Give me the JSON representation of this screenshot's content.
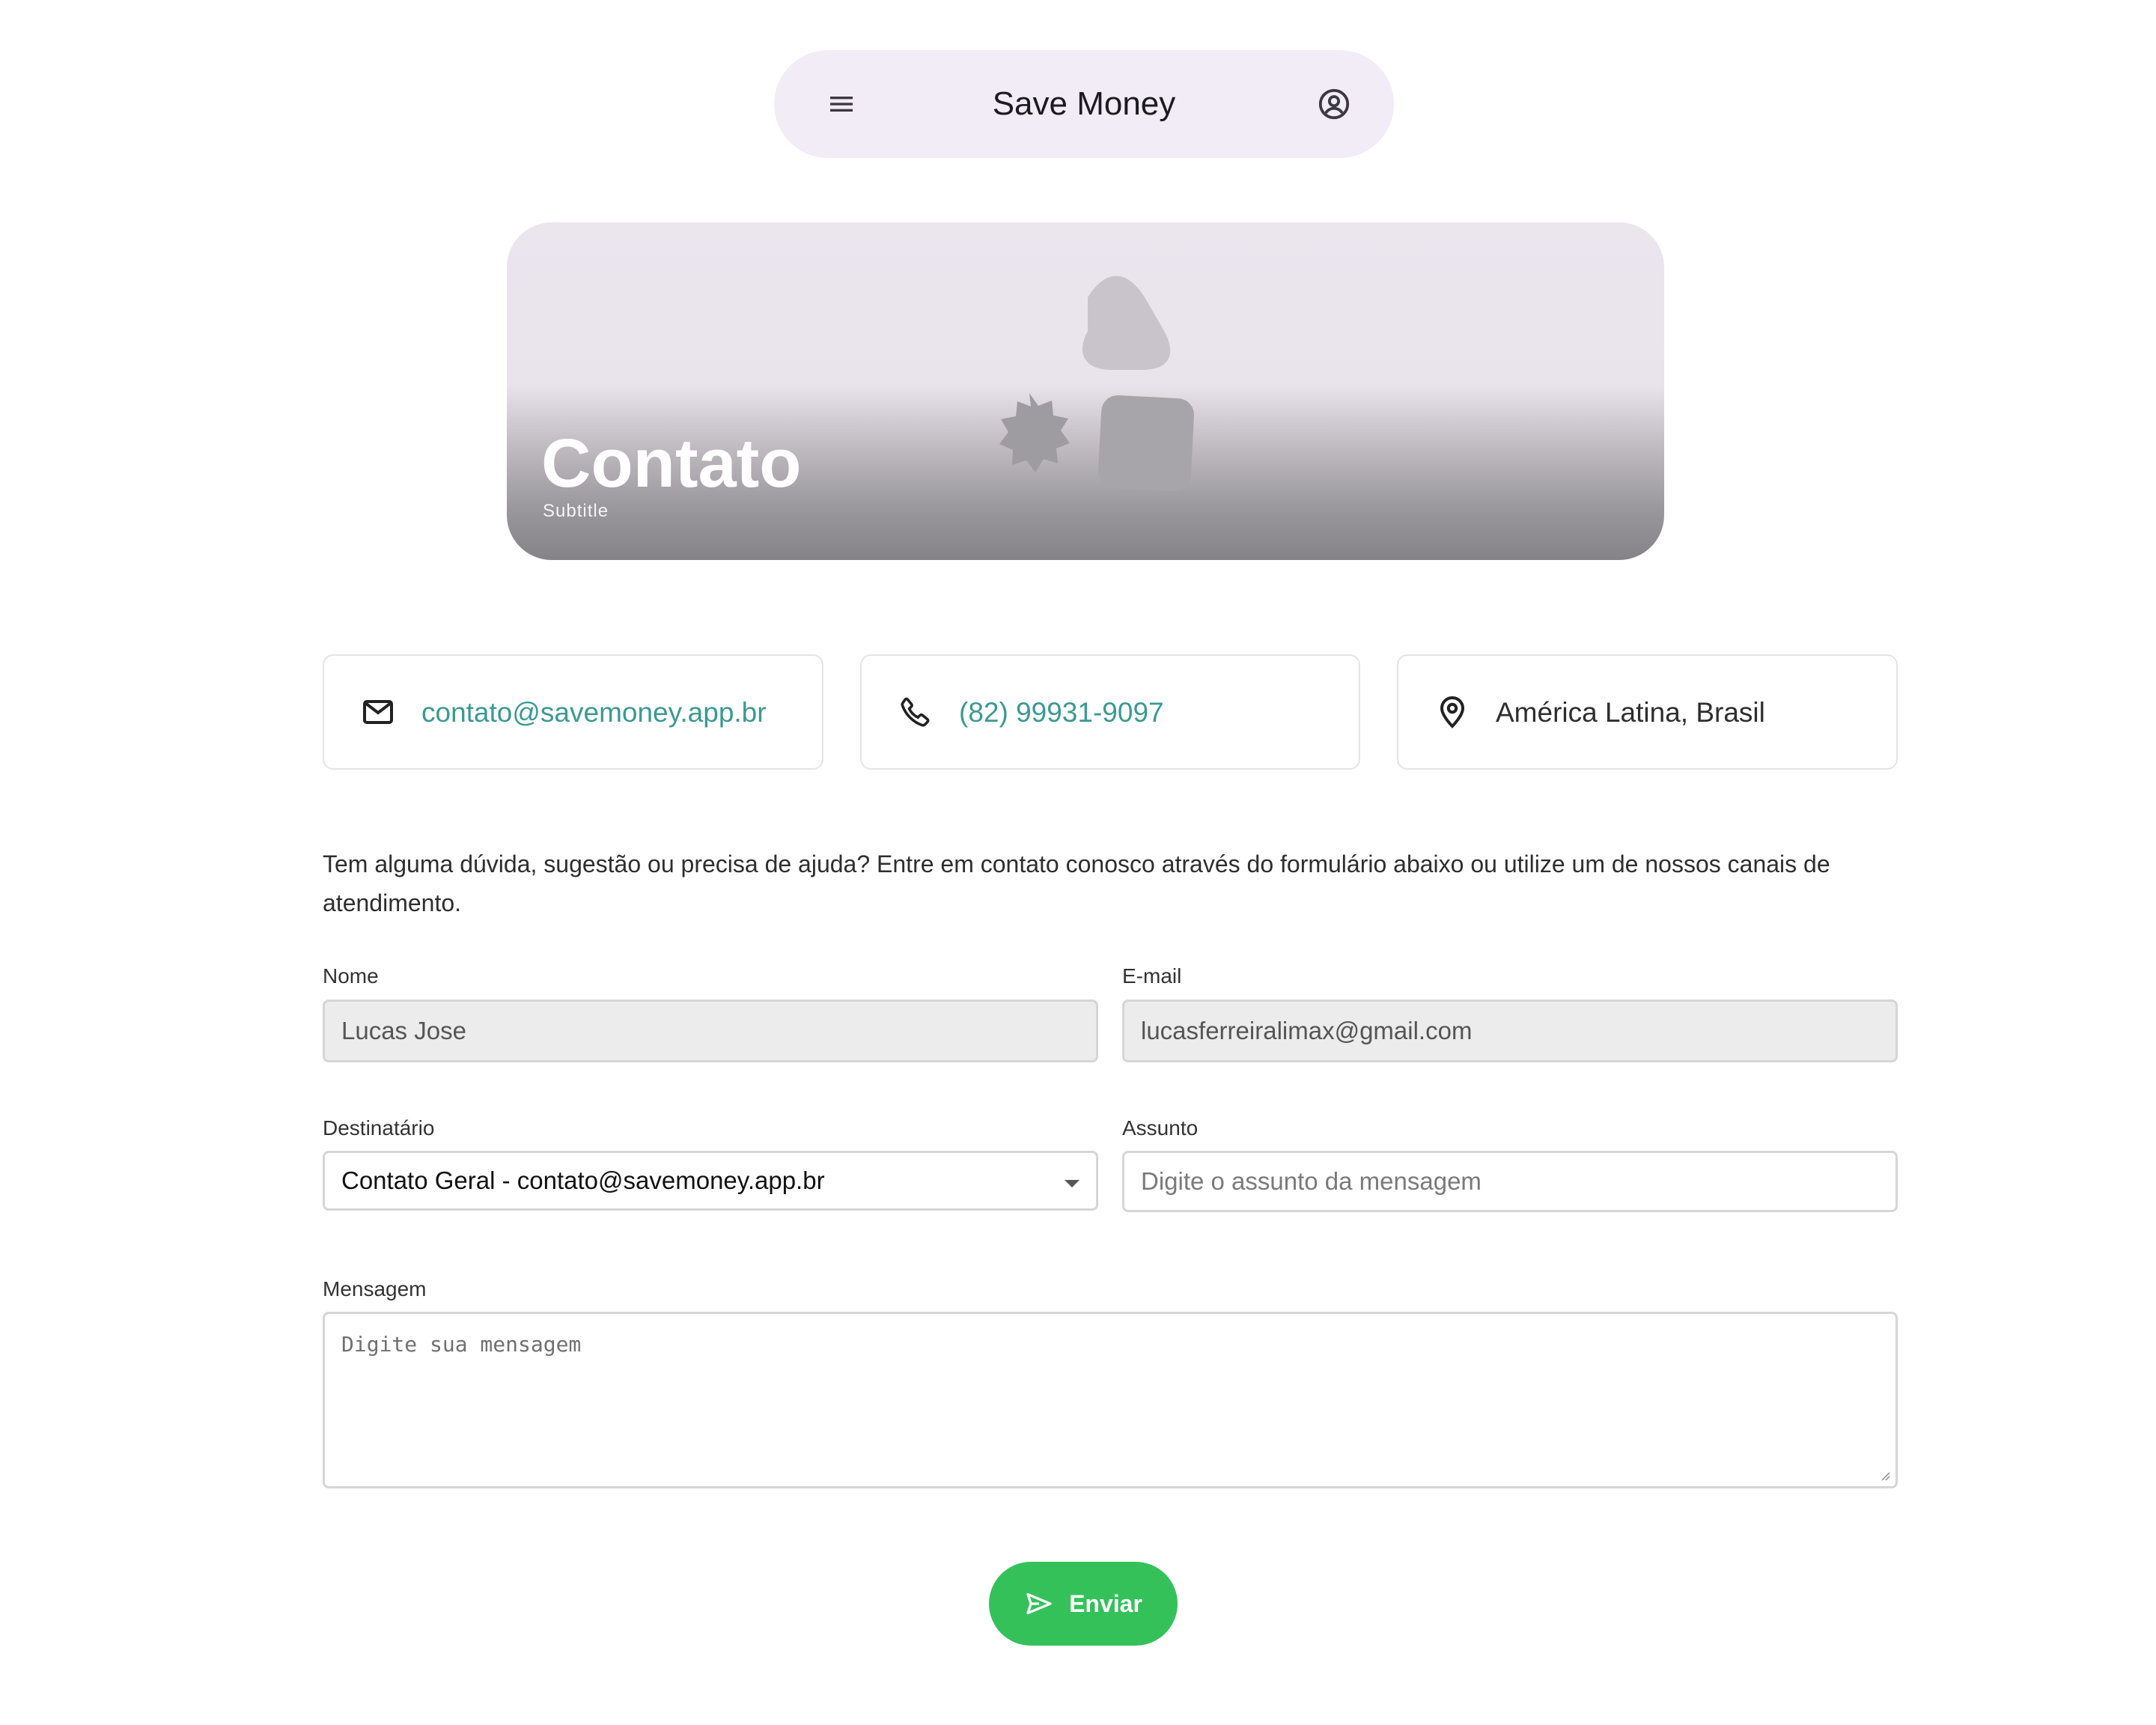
{
  "appbar": {
    "title": "Save Money",
    "menu_icon": "menu-icon",
    "account_icon": "account-circle-icon"
  },
  "hero": {
    "title": "Contato",
    "subtitle": "Subtitle"
  },
  "info_cards": [
    {
      "icon": "mail-icon",
      "text": "contato@savemoney.app.br",
      "link": true
    },
    {
      "icon": "phone-icon",
      "text": "(82) 99931-9097",
      "link": true
    },
    {
      "icon": "location-pin-icon",
      "text": "América Latina, Brasil",
      "link": false
    }
  ],
  "intro_text": "Tem alguma dúvida, sugestão ou precisa de ajuda? Entre em contato conosco através do formulário abaixo ou utilize um de nossos canais de atendimento.",
  "form": {
    "name": {
      "label": "Nome",
      "value": "Lucas Jose"
    },
    "email": {
      "label": "E-mail",
      "value": "lucasferreiralimax@gmail.com"
    },
    "recipient": {
      "label": "Destinatário",
      "value": "Contato Geral - contato@savemoney.app.br"
    },
    "subject": {
      "label": "Assunto",
      "placeholder": "Digite o assunto da mensagem"
    },
    "message": {
      "label": "Mensagem",
      "placeholder": "Digite sua mensagem"
    },
    "submit_label": "Enviar"
  },
  "colors": {
    "appbar_bg": "#f1ecf6",
    "link": "#3a9a92",
    "send_button": "#34c15a"
  }
}
